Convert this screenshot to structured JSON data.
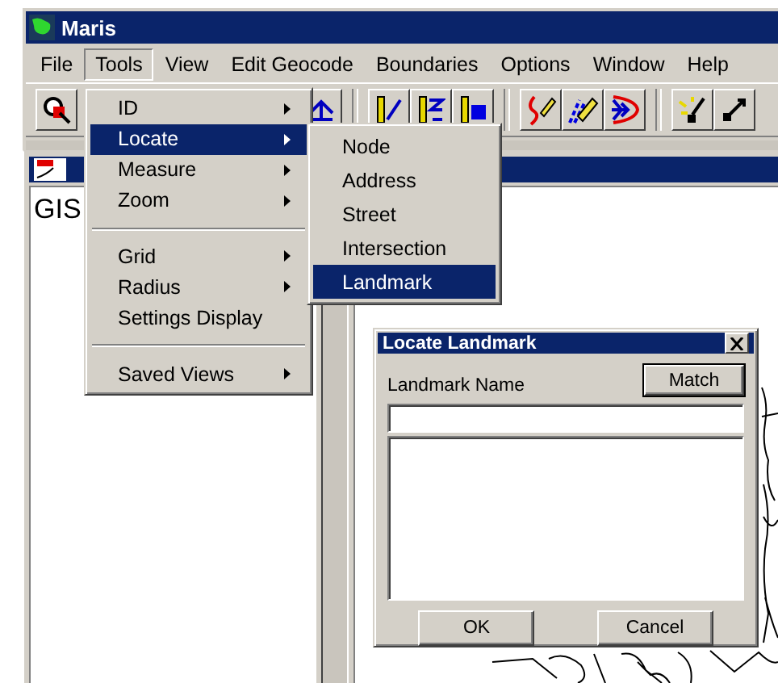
{
  "window": {
    "title": "Maris"
  },
  "menu_bar": [
    {
      "label": "File",
      "selected": false
    },
    {
      "label": "Tools",
      "selected": true
    },
    {
      "label": "View",
      "selected": false
    },
    {
      "label": "Edit Geocode",
      "selected": false
    },
    {
      "label": "Boundaries",
      "selected": false
    },
    {
      "label": "Options",
      "selected": false
    },
    {
      "label": "Window",
      "selected": false
    },
    {
      "label": "Help",
      "selected": false
    }
  ],
  "child_window": {
    "text": "GIS"
  },
  "tools_menu": [
    {
      "kind": "item",
      "label": "ID",
      "submenu": true,
      "selected": false
    },
    {
      "kind": "item",
      "label": "Locate",
      "submenu": true,
      "selected": true
    },
    {
      "kind": "item",
      "label": "Measure",
      "submenu": true,
      "selected": false
    },
    {
      "kind": "item",
      "label": "Zoom",
      "submenu": true,
      "selected": false
    },
    {
      "kind": "separator"
    },
    {
      "kind": "item",
      "label": "Grid",
      "submenu": true,
      "selected": false
    },
    {
      "kind": "item",
      "label": "Radius",
      "submenu": true,
      "selected": false
    },
    {
      "kind": "item",
      "label": "Settings Display",
      "submenu": false,
      "selected": false
    },
    {
      "kind": "separator"
    },
    {
      "kind": "item",
      "label": "Saved Views",
      "submenu": true,
      "selected": false
    }
  ],
  "locate_submenu": [
    {
      "label": "Node",
      "selected": false
    },
    {
      "label": "Address",
      "selected": false
    },
    {
      "label": "Street",
      "selected": false
    },
    {
      "label": "Intersection",
      "selected": false
    },
    {
      "label": "Landmark",
      "selected": true
    }
  ],
  "dialog": {
    "title": "Locate Landmark",
    "field_label": "Landmark Name",
    "match_button": "Match",
    "buttons": [
      "OK",
      "Cancel"
    ]
  }
}
